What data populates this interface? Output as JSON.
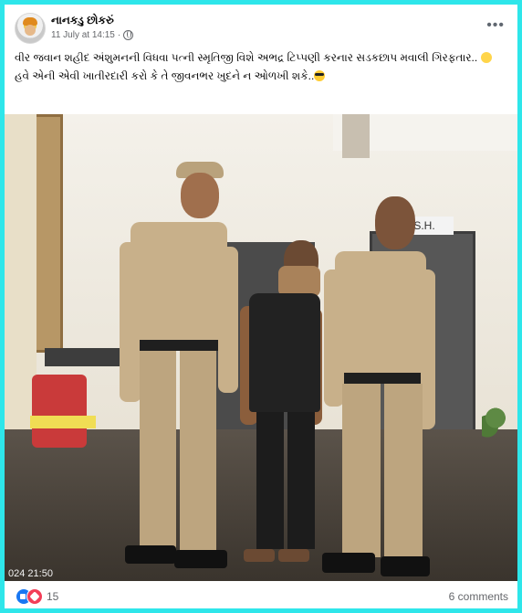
{
  "post": {
    "author": "નાનકડુ છોકરું",
    "date": "11 July at 14:15",
    "separator": "·",
    "line1": "વીર જવાન શહીદ અંશુમનની વિધવા પત્ની સ્મૃતિજી વિશે અભદ્ર ટિપ્પણી કરનાર સડકછાપ મવાલી ગિરફતાર..",
    "line2": "હવે એની એવી ખાતીરદારી કરો કે તે જીવનભર ખુદને ન ઓળખી શકે.."
  },
  "photo": {
    "sign_text": "S.H.",
    "timestamp_text": "024 21:50"
  },
  "engagement": {
    "reaction_count": "15",
    "comments_label": "6 comments"
  },
  "icons": [
    "avatar",
    "globe-icon",
    "more-options-icon",
    "like-reaction-icon",
    "love-reaction-icon",
    "face-with-rolling-eyes-emoji",
    "smiling-face-with-sunglasses-emoji"
  ]
}
